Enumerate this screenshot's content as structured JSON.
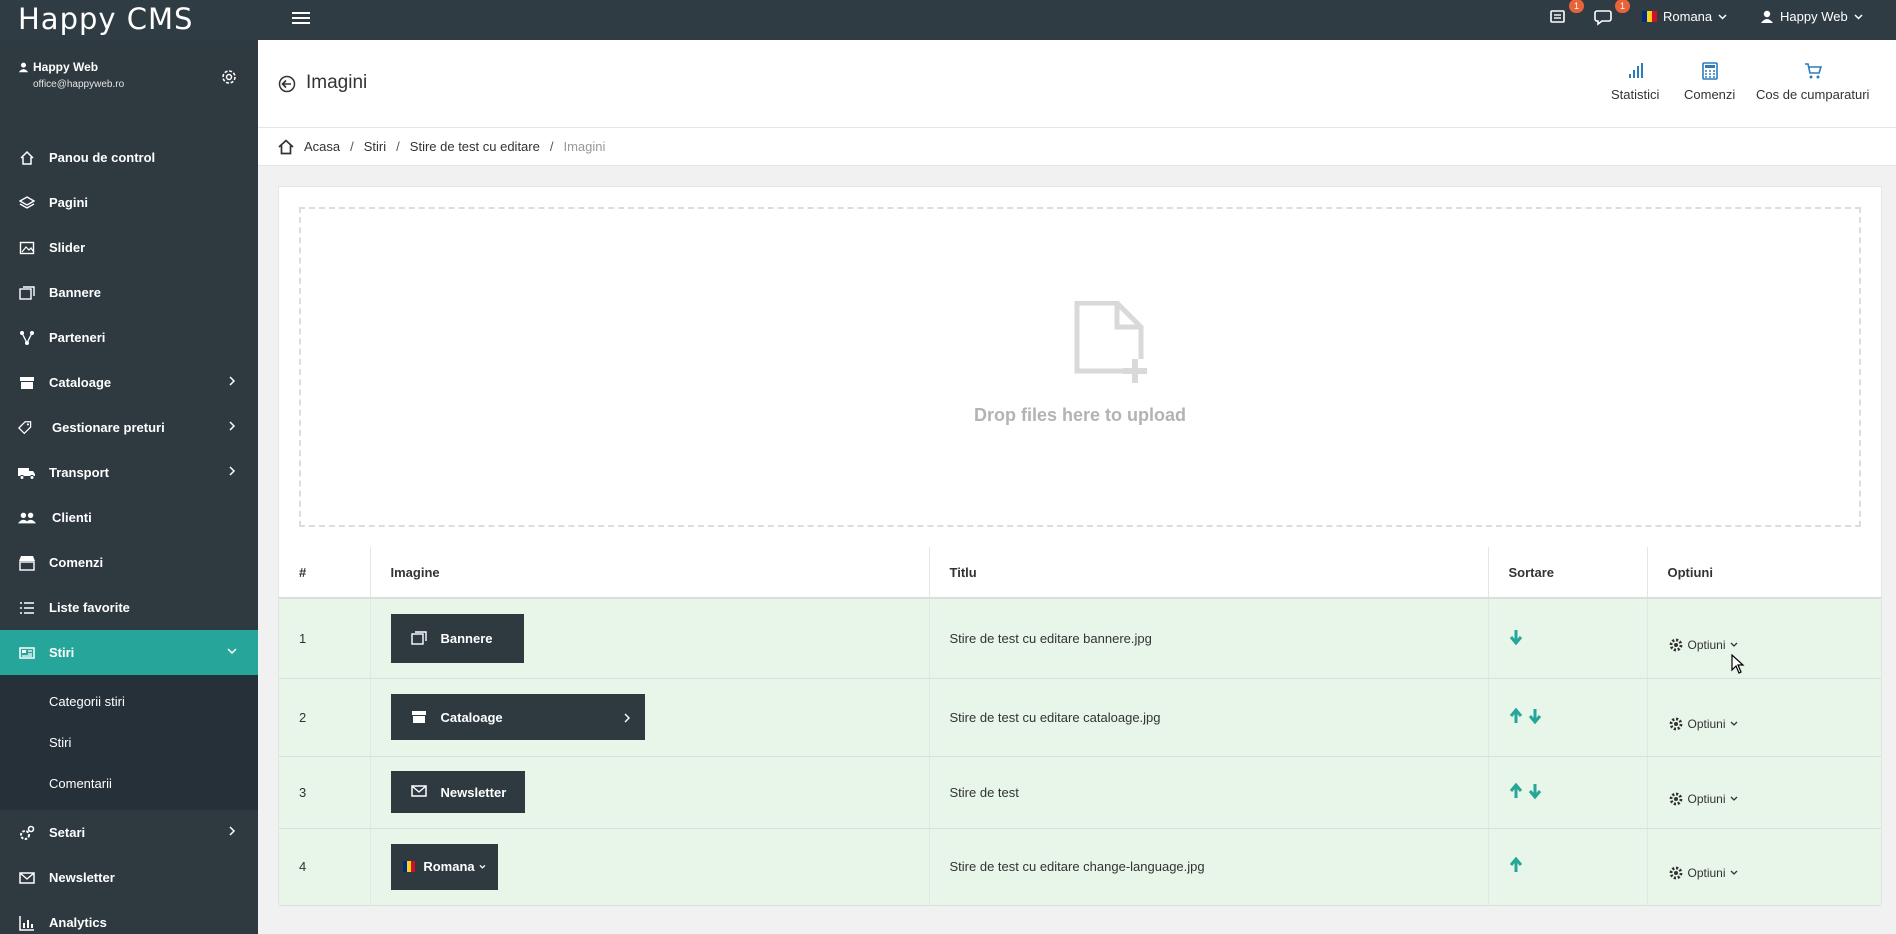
{
  "app": {
    "logo": "Happy CMS"
  },
  "topbar": {
    "notif_badge": "1",
    "chat_badge": "1",
    "language": "Romana",
    "user": "Happy Web"
  },
  "sidebar": {
    "profile_name": "Happy Web",
    "profile_email": "office@happyweb.ro",
    "items": [
      {
        "label": "Panou de control",
        "icon": "home-icon"
      },
      {
        "label": "Pagini",
        "icon": "layers-icon"
      },
      {
        "label": "Slider",
        "icon": "image-icon"
      },
      {
        "label": "Bannere",
        "icon": "images-icon"
      },
      {
        "label": "Parteneri",
        "icon": "network-icon"
      },
      {
        "label": "Cataloage",
        "icon": "archive-icon"
      },
      {
        "label": "Gestionare preturi",
        "icon": "tags-icon"
      },
      {
        "label": "Transport",
        "icon": "truck-icon"
      },
      {
        "label": "Clienti",
        "icon": "users-icon"
      },
      {
        "label": "Comenzi",
        "icon": "store-icon"
      },
      {
        "label": "Liste favorite",
        "icon": "list-icon"
      },
      {
        "label": "Stiri",
        "icon": "newspaper-icon"
      },
      {
        "label": "Setari",
        "icon": "cogs-icon"
      },
      {
        "label": "Newsletter",
        "icon": "envelope-icon"
      },
      {
        "label": "Analytics",
        "icon": "chart-icon"
      }
    ],
    "sub_items": [
      "Categorii stiri",
      "Stiri",
      "Comentarii"
    ]
  },
  "header": {
    "title": "Imagini",
    "links": [
      "Statistici",
      "Comenzi",
      "Cos de cumparaturi"
    ]
  },
  "breadcrumb": [
    "Acasa",
    "Stiri",
    "Stire de test cu editare",
    "Imagini"
  ],
  "dropzone": {
    "text": "Drop files here to upload"
  },
  "table": {
    "headers": [
      "#",
      "Imagine",
      "Titlu",
      "Sortare",
      "Optiuni"
    ],
    "option_label": "Optiuni",
    "rows": [
      {
        "num": "1",
        "image_label": "Bannere",
        "title": "Stire de test cu editare bannere.jpg"
      },
      {
        "num": "2",
        "image_label": "Cataloage",
        "title": "Stire de test cu editare cataloage.jpg"
      },
      {
        "num": "3",
        "image_label": "Newsletter",
        "title": "Stire de test"
      },
      {
        "num": "4",
        "image_label": "Romana",
        "title": "Stire de test cu editare change-language.jpg"
      }
    ]
  },
  "colors": {
    "topbar": "#2f3c44",
    "sidebar": "#2e3940",
    "accent": "#26a69a",
    "row_bg": "#e8f5e9",
    "badge": "#e8623a"
  }
}
